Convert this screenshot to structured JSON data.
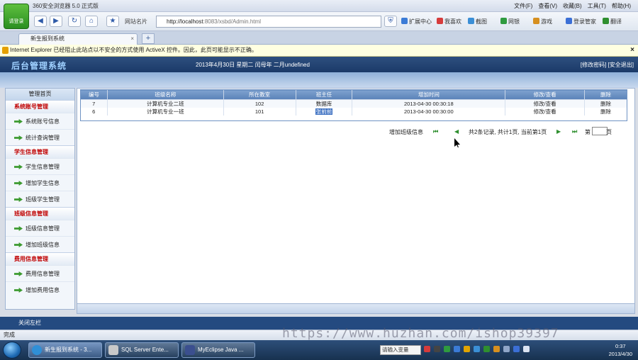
{
  "browser": {
    "logo_label": "请登录",
    "title": "360安全浏览器 5.0 正式版",
    "menu": [
      "文件(F)",
      "查看(V)",
      "收藏(B)",
      "工具(T)",
      "帮助(H)"
    ],
    "fav_label": "网站名片",
    "address_host": "http://localhost",
    "address_rest": ":8083/xsbd/Admin.html",
    "tools": [
      "扩展中心",
      "我喜欢",
      "截图",
      "网银",
      "游戏",
      "登录管家",
      "翻译"
    ],
    "tool_colors": [
      "#3b7bd6",
      "#d63b3b",
      "#3b8fd6",
      "#2f9b3f",
      "#d68f1f",
      "#3b6fd6",
      "#2f8f2f"
    ],
    "tab_title": "新生报到系统",
    "infobar_text": "Internet Explorer 已经阻止此站点以不安全的方式使用 ActiveX 控件。因此，此页可能显示不正确。",
    "status_text": "完成",
    "watermark": "https://www.huzhan.com/ishop39397"
  },
  "header": {
    "title": "后台管理系统",
    "date_text": "2013年4月30日 星期二  闰母年  二月undefined",
    "links": "[修改密码] [安全退出]"
  },
  "sidebar": {
    "home_label": "管理首页",
    "groups": [
      {
        "title": "系统账号管理",
        "items": [
          "系统账号信息",
          "统计查询管理"
        ]
      },
      {
        "title": "学生信息管理",
        "items": [
          "学生信息管理",
          "增加学生信息",
          "班级学生管理"
        ]
      },
      {
        "title": "班级信息管理",
        "items": [
          "班级信息管理",
          "增加班级信息"
        ]
      },
      {
        "title": "费用信息管理",
        "items": [
          "费用信息管理",
          "增加费用信息"
        ]
      }
    ],
    "close_left": "关闭左栏"
  },
  "table": {
    "headers": [
      "编号",
      "班级名称",
      "所在教室",
      "班主任",
      "增加时间",
      "修改/查看",
      "删除"
    ],
    "rows": [
      [
        "7",
        "计算机专业二班",
        "102",
        "数据库",
        "2013-04-30 00:30:18",
        "修改/查看",
        "删除"
      ],
      [
        "6",
        "计算机专业一班",
        "101",
        "张前前",
        "2013-04-30 00:30:00",
        "修改/查看",
        "删除"
      ]
    ]
  },
  "pager": {
    "add_label": "增加班级信息",
    "first": "⏮",
    "prev": "◀",
    "summary": "共2条记录, 共计1页, 当前第1页",
    "next": "▶",
    "last": "⏭",
    "go_prefix": "第",
    "go_suffix": "页"
  },
  "taskbar": {
    "tasks": [
      "新生报到系统 - 3...",
      "SQL Server Ente...",
      "MyEclipse Java ..."
    ],
    "ime": "请输入变量",
    "time": "0:37",
    "date": "2013/4/30"
  }
}
